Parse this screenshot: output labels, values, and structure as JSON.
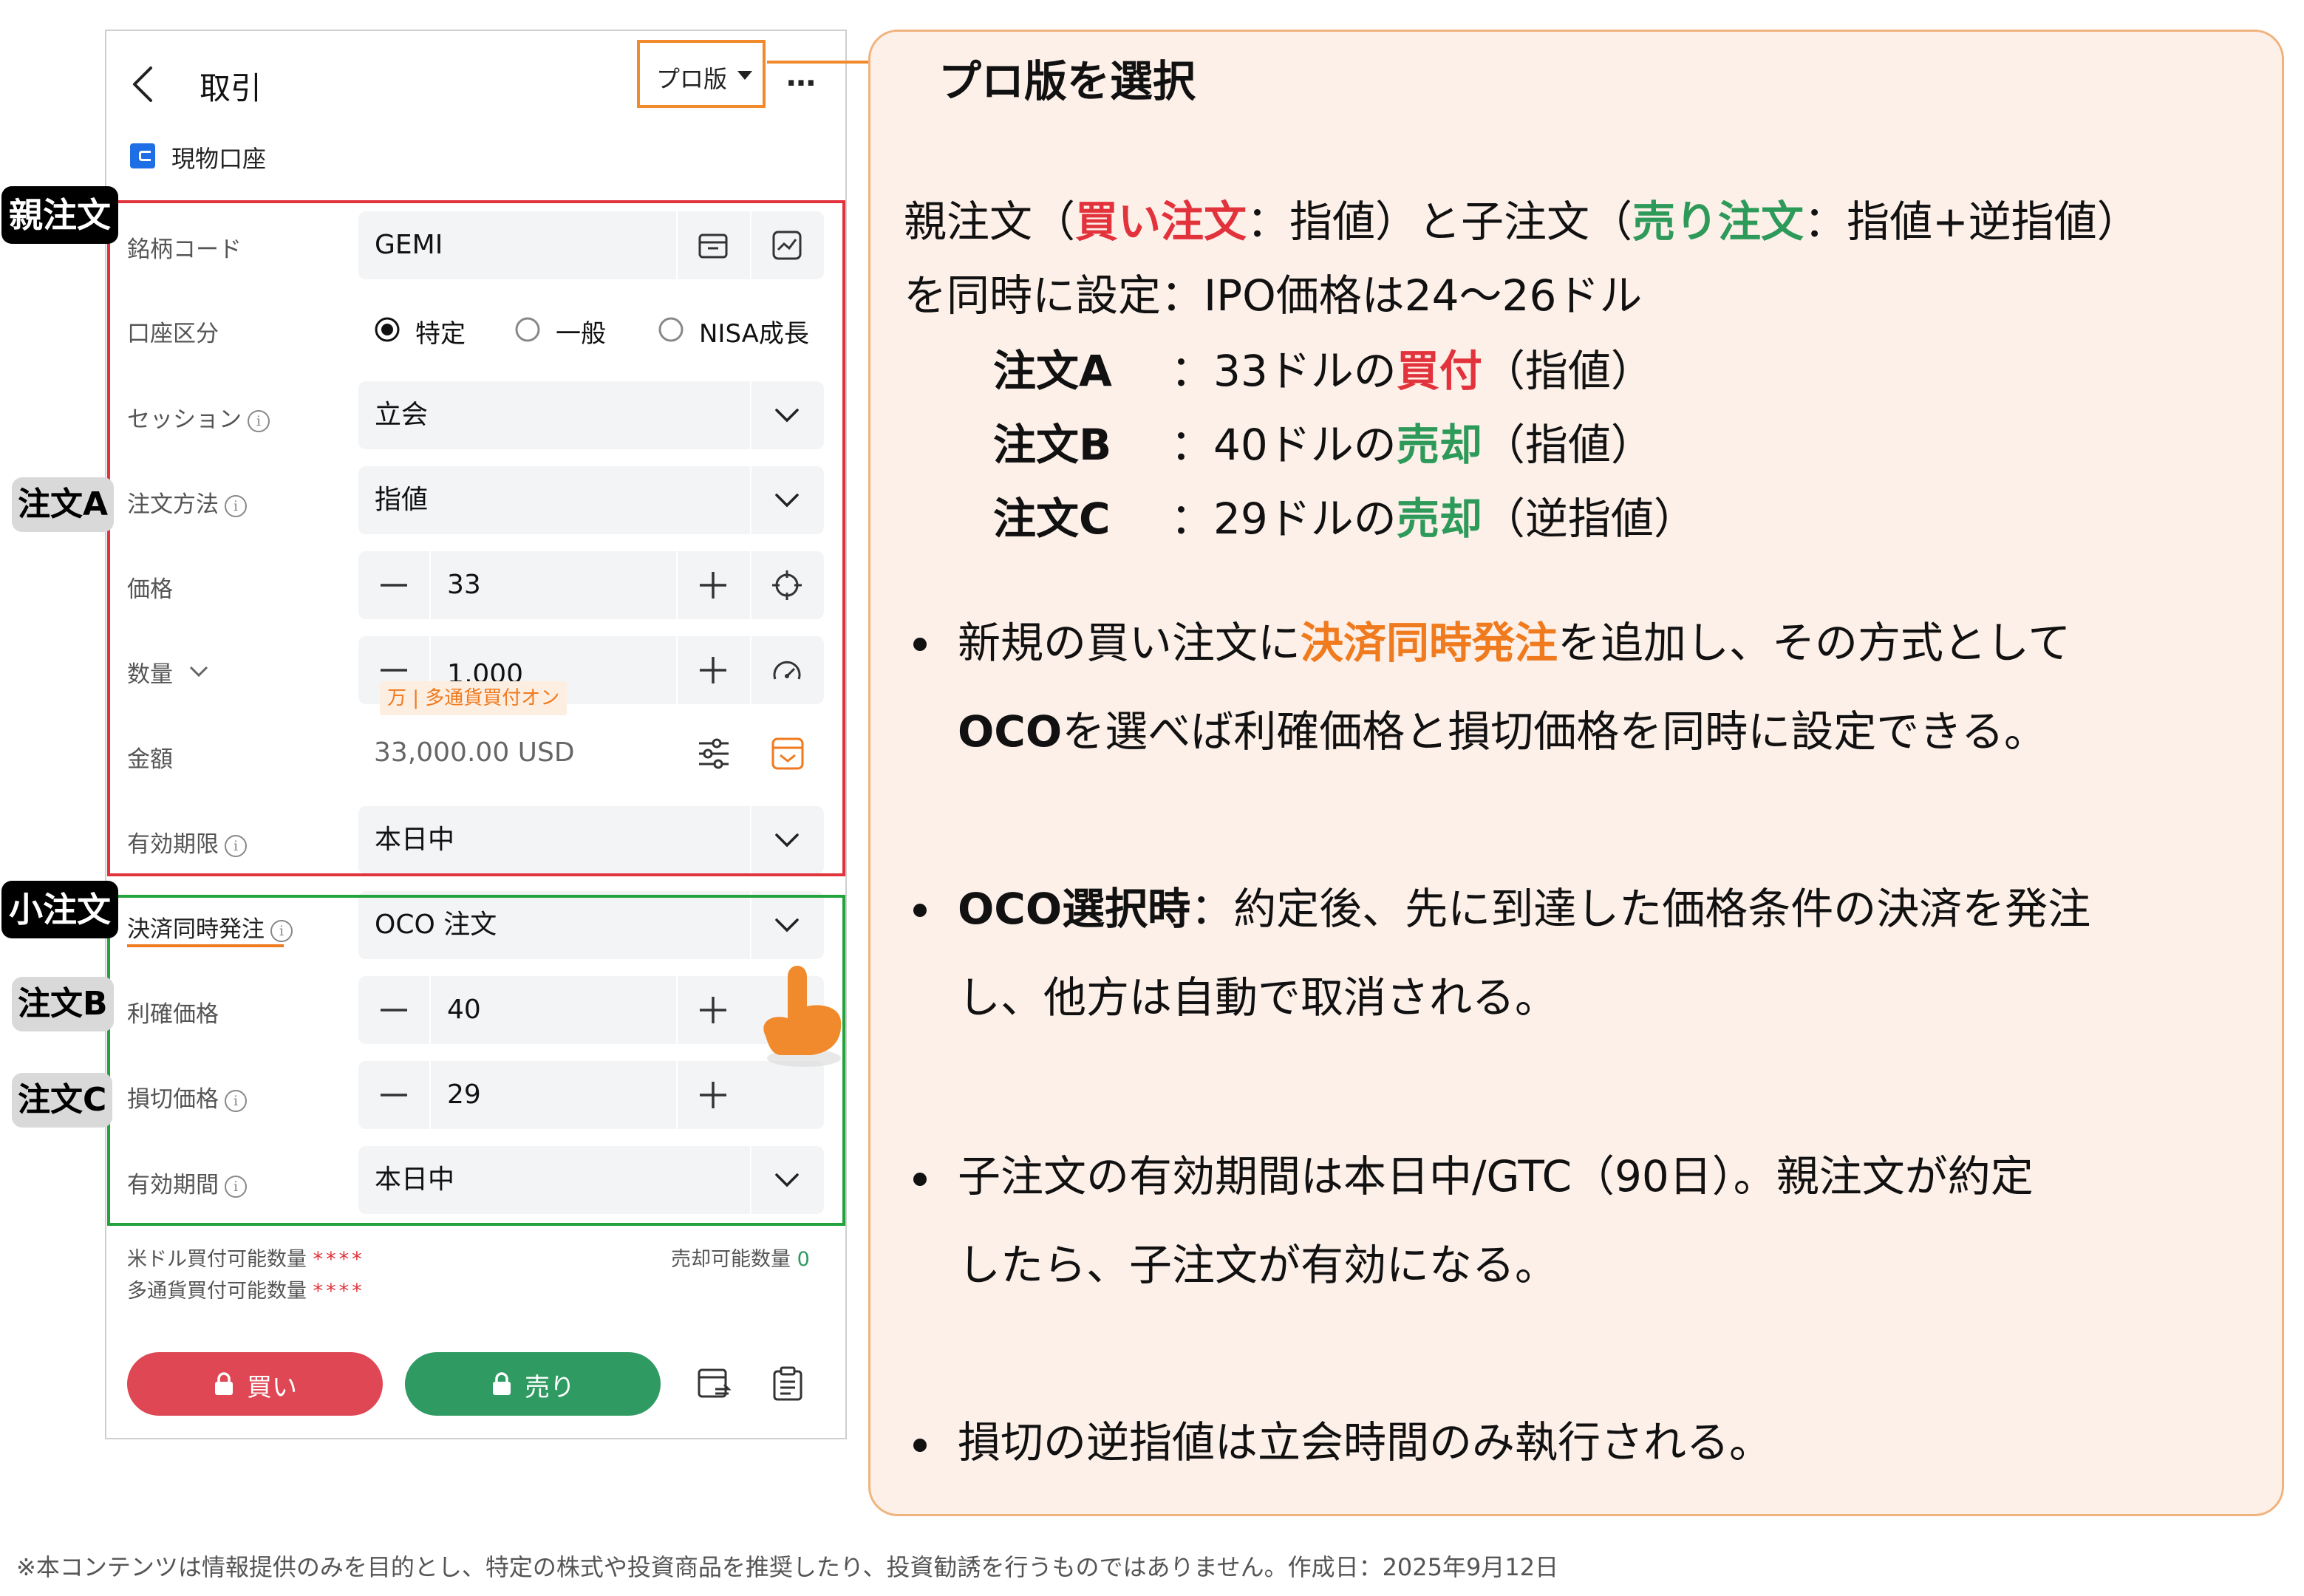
{
  "header": {
    "title": "取引",
    "pro_button": "プロ版",
    "more": "…",
    "account": "現物口座"
  },
  "annotations": {
    "pro_callout": "プロ版を選択",
    "parent_tag": "親注文",
    "child_tag": "小注文",
    "order_a_tag": "注文A",
    "order_b_tag": "注文B",
    "order_c_tag": "注文C"
  },
  "form": {
    "symbol": {
      "label": "銘柄コード",
      "value": "GEMI"
    },
    "account_type": {
      "label": "口座区分",
      "options": [
        "特定",
        "一般",
        "NISA成長"
      ],
      "selected": "特定"
    },
    "session": {
      "label": "セッション",
      "value": "立会"
    },
    "order_method": {
      "label": "注文方法",
      "value": "指値"
    },
    "price": {
      "label": "価格",
      "value": "33"
    },
    "quantity": {
      "label": "数量",
      "value": "1,000",
      "hint": "万 | 多通貨買付オン"
    },
    "amount": {
      "label": "金額",
      "value": "33,000.00 USD"
    },
    "validity": {
      "label": "有効期限",
      "value": "本日中"
    },
    "settlement": {
      "label": "決済同時発注",
      "value": "OCO 注文"
    },
    "take_profit": {
      "label": "利確価格",
      "value": "40"
    },
    "stop_loss": {
      "label": "損切価格",
      "value": "29"
    },
    "child_validity": {
      "label": "有効期間",
      "value": "本日中"
    }
  },
  "footer": {
    "usd_buying_power_label": "米ドル買付可能数量",
    "usd_buying_power_value": "****",
    "multi_buying_power_label": "多通貨買付可能数量",
    "multi_buying_power_value": "****",
    "sell_qty_label": "売却可能数量",
    "sell_qty_value": "0",
    "buy_button": "買い",
    "sell_button": "売り"
  },
  "explanation": {
    "line1_parts": [
      "親注文（",
      "買い注文",
      "：指値）と子注文（",
      "売り注文",
      "：指値+逆指値）"
    ],
    "line2": "を同時に設定：IPO価格は24〜26ドル",
    "orders": [
      {
        "name": "注文A",
        "pre": "：33ドルの",
        "action": "買付",
        "post": "（指値）",
        "color": "red"
      },
      {
        "name": "注文B",
        "pre": "：40ドルの",
        "action": "売却",
        "post": "（指値）",
        "color": "green"
      },
      {
        "name": "注文C",
        "pre": "：29ドルの",
        "action": "売却",
        "post": "（逆指値）",
        "color": "green"
      }
    ],
    "bullet1": {
      "pre": "新規の買い注文に",
      "highlight": "決済同時発注",
      "post": "を追加し、その方式として",
      "line2_bold": "OCO",
      "line2_rest": "を選べば利確価格と損切価格を同時に設定できる。"
    },
    "bullet2": {
      "bold": "OCO選択時",
      "rest": "：約定後、先に到達した価格条件の決済を発注",
      "line2": "し、他方は自動で取消される。"
    },
    "bullet3": {
      "line1": "子注文の有効期間は本日中/GTC（90日）。親注文が約定",
      "line2": "したら、子注文が有効になる。"
    },
    "bullet4": "損切の逆指値は立会時間のみ執行される。"
  },
  "disclaimer": "※本コンテンツは情報提供のみを目的とし、特定の株式や投資商品を推奨したり、投資勧誘を行うものではありません。作成日：2025年9月12日",
  "colors": {
    "red_frame": "#e2323c",
    "green_frame": "#22a33b",
    "orange": "#f07a1e",
    "buy": "#de4753",
    "sell": "#2f9a62",
    "panel_bg": "#fdf0e9"
  }
}
